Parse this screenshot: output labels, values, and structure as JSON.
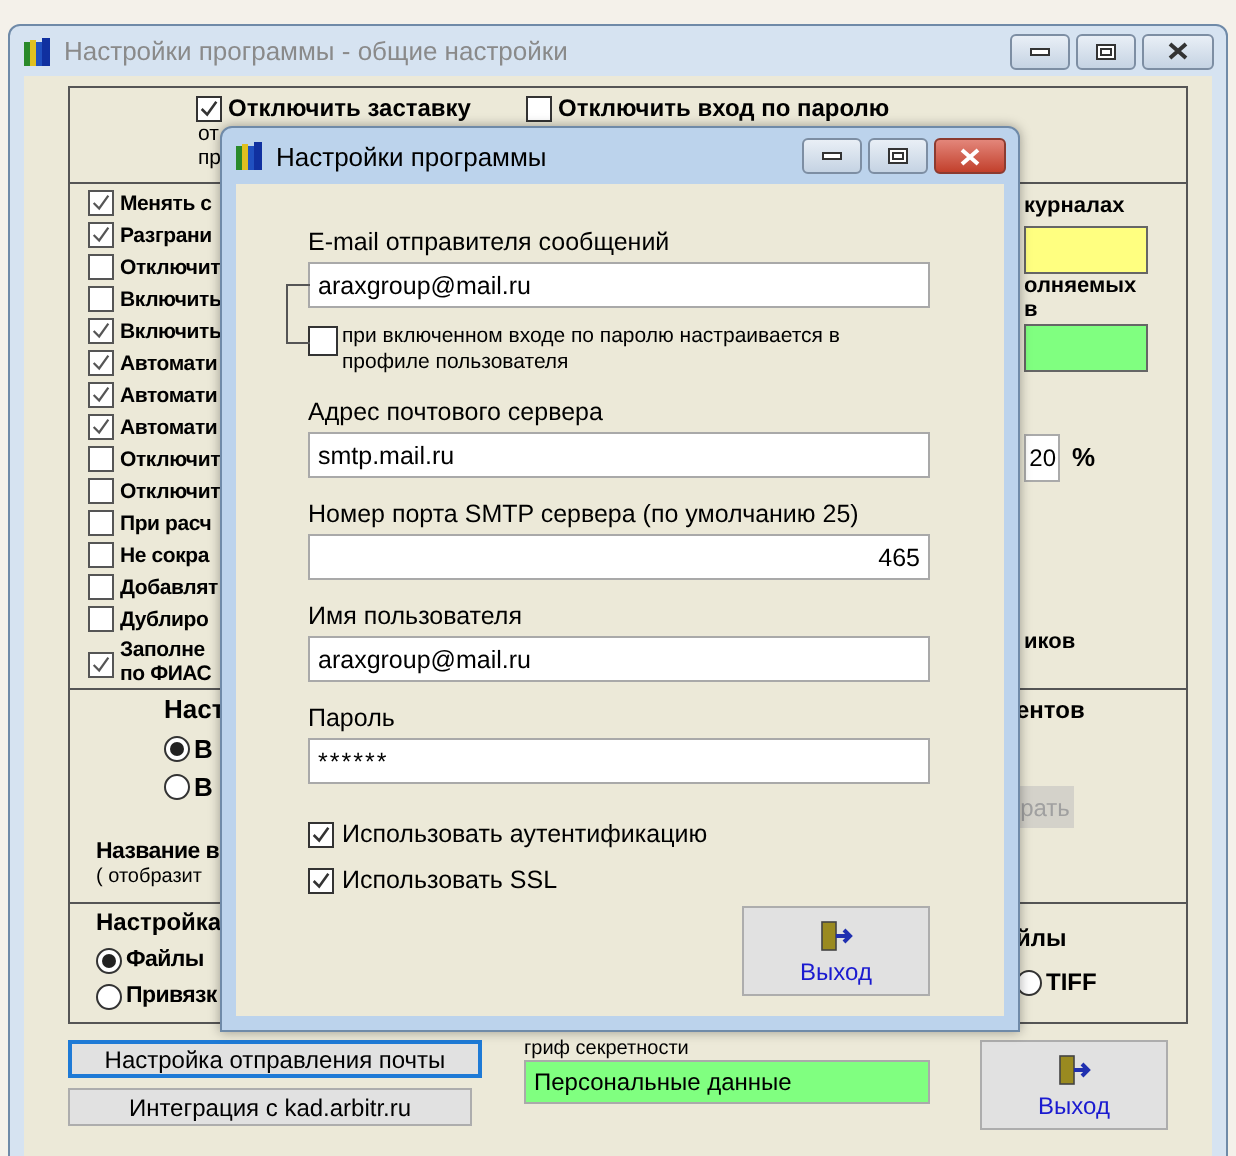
{
  "main_window": {
    "title": "Настройки программы - общие настройки"
  },
  "top_options": [
    {
      "label": "Отключить заставку",
      "checked": true,
      "note": [
        "от",
        "пр"
      ]
    },
    {
      "label": "Отключить вход по паролю",
      "checked": false
    }
  ],
  "options": [
    {
      "label": "Менять с",
      "checked": true
    },
    {
      "label": "Разграни",
      "checked": true
    },
    {
      "label": "Отключит",
      "checked": false
    },
    {
      "label": "Включить",
      "checked": false
    },
    {
      "label": "Включить",
      "checked": true
    },
    {
      "label": "Автомати",
      "checked": true
    },
    {
      "label": "Автомати",
      "checked": true
    },
    {
      "label": "Автомати",
      "checked": true
    },
    {
      "label": "Отключит",
      "checked": false
    },
    {
      "label": "Отключит",
      "checked": false
    },
    {
      "label": "При расч",
      "checked": false
    },
    {
      "label": "Не сокра",
      "checked": false
    },
    {
      "label": "Добавлят",
      "checked": false
    },
    {
      "label": "Дублиро",
      "checked": false
    },
    {
      "label": "Заполне по ФИАС",
      "checked": true
    }
  ],
  "right_column": {
    "text_1": "курналах",
    "field_1": {
      "color": "#ffff80"
    },
    "text_2": [
      "олняемых",
      "в"
    ],
    "field_2": {
      "color": "#80ff80"
    },
    "percent_field": {
      "value": "20",
      "unit": "%"
    },
    "text_3": "иков"
  },
  "section_2": {
    "heading": "Наст",
    "radios": [
      {
        "label": "В",
        "selected": true
      },
      {
        "label": "В",
        "selected": false
      }
    ],
    "name_label": "Название в",
    "name_hint": "( отобразит",
    "right_heading": "ентов",
    "right_button": {
      "label": "рать",
      "disabled": true
    }
  },
  "section_3": {
    "heading": "Настройка",
    "radios": [
      {
        "label": "Файлы",
        "selected": true
      },
      {
        "label": "Привязк",
        "selected": false
      }
    ],
    "right_heading": "йлы",
    "right_radio": {
      "label": "TIFF",
      "selected": false
    }
  },
  "bottom": {
    "buttons": [
      {
        "label": "Настройка отправления почты",
        "focused": true
      },
      {
        "label": "Интеграция с kad.arbitr.ru",
        "focused": false
      }
    ],
    "secrecy_label": "гриф секретности",
    "secrecy_value": "Персональные данные",
    "exit_button": "Выход"
  },
  "dialog": {
    "title": "Настройки программы",
    "sender": {
      "label": "E-mail отправителя сообщений",
      "value": "araxgroup@mail.ru"
    },
    "profile_checkbox": {
      "label": "при включенном входе по паролю настраивается в профиле пользователя",
      "checked": false
    },
    "fields": [
      {
        "label": "Адрес почтового сервера",
        "value": "smtp.mail.ru",
        "kind": "text"
      },
      {
        "label": "Номер порта SMTP сервера (по умолчанию 25)",
        "value": "465",
        "kind": "number"
      },
      {
        "label": "Имя пользователя",
        "value": "araxgroup@mail.ru",
        "kind": "text"
      },
      {
        "label": "Пароль",
        "value": "******",
        "kind": "password"
      }
    ],
    "checkboxes": [
      {
        "label": "Использовать аутентификацию",
        "checked": true
      },
      {
        "label": "Использовать SSL",
        "checked": true
      }
    ],
    "exit_button": "Выход"
  }
}
